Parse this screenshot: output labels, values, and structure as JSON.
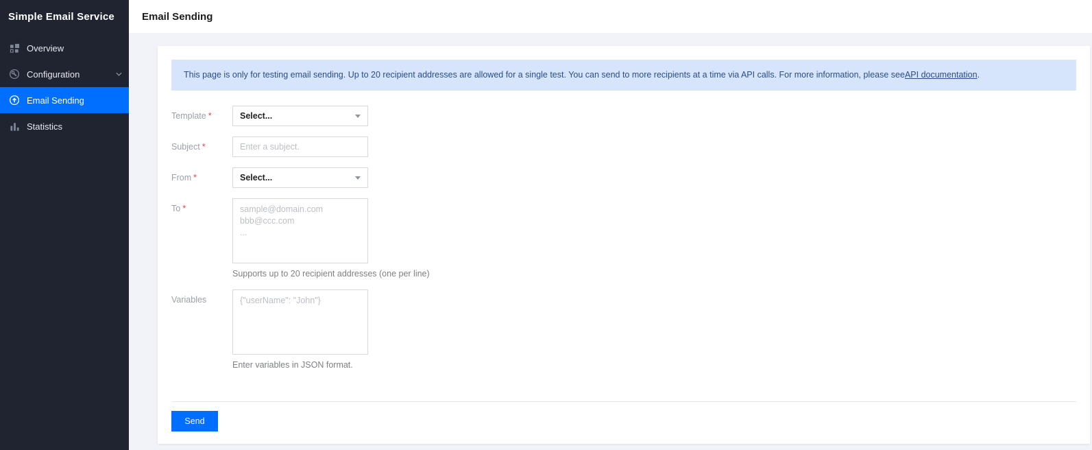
{
  "sidebar": {
    "title": "Simple Email Service",
    "items": [
      {
        "label": "Overview",
        "icon": "grid-icon"
      },
      {
        "label": "Configuration",
        "icon": "wrench-icon",
        "has_submenu": true
      },
      {
        "label": "Email Sending",
        "icon": "send-icon",
        "active": true
      },
      {
        "label": "Statistics",
        "icon": "bar-chart-icon"
      }
    ]
  },
  "header": {
    "title": "Email Sending"
  },
  "banner": {
    "text_before_link": "This page is only for testing email sending. Up to 20 recipient addresses are allowed for a single test. You can send to more recipients at a time via API calls. For more information, please see ",
    "link_text": "API documentation",
    "text_after_link": "."
  },
  "form": {
    "fields": [
      {
        "label": "Template",
        "required_mark": "*",
        "control": "select",
        "value": "Select..."
      },
      {
        "label": "Subject",
        "required_mark": "*",
        "control": "input",
        "placeholder": "Enter a subject."
      },
      {
        "label": "From",
        "required_mark": "*",
        "control": "select",
        "value": "Select..."
      },
      {
        "label": "To",
        "required_mark": "*",
        "control": "textarea",
        "placeholder": "sample@domain.com\nbbb@ccc.com\n...",
        "helper": "Supports up to 20 recipient addresses (one per line)"
      },
      {
        "label": "Variables",
        "required_mark": "",
        "control": "textarea",
        "placeholder": "{\"userName\": \"John\"}",
        "helper": "Enter variables in JSON format."
      }
    ],
    "send_label": "Send"
  },
  "colors": {
    "accent_blue": "#006eff",
    "sidebar_bg": "#1f2430",
    "banner_bg": "#d6e5fb",
    "banner_text": "#2a4e85",
    "required_red": "#e54545",
    "page_bg": "#f2f3f8"
  }
}
